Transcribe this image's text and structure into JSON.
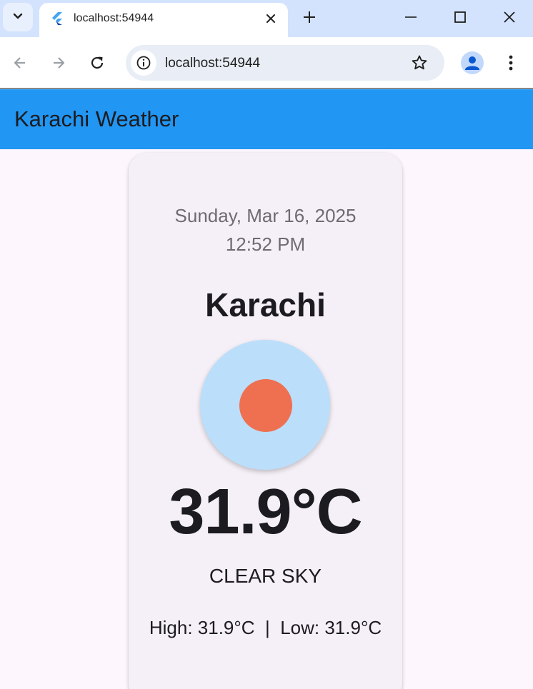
{
  "browser": {
    "tab_title": "localhost:54944",
    "url": "localhost:54944",
    "icons": {
      "tab_search": "chevron-down-icon",
      "favicon": "flutter-icon",
      "tab_close": "close-icon",
      "new_tab": "plus-icon",
      "minimize": "minimize-icon",
      "maximize": "maximize-icon",
      "close_window": "close-icon",
      "back": "arrow-left-icon",
      "forward": "arrow-right-icon",
      "reload": "reload-icon",
      "site_info": "info-icon",
      "bookmark": "star-icon",
      "profile": "person-icon",
      "menu": "kebab-icon"
    }
  },
  "app": {
    "title": "Karachi Weather",
    "colors": {
      "app_bar": "#2196f3",
      "page_bg": "#fdf7fd",
      "card_bg": "#f5f0f7",
      "icon_circle": "#bbdefb",
      "sun": "#ee7050"
    }
  },
  "weather": {
    "date": "Sunday, Mar 16, 2025",
    "time": "12:52 PM",
    "city": "Karachi",
    "temperature": "31.9°C",
    "description": "CLEAR SKY",
    "high_low": "High: 31.9°C  |  Low: 31.9°C",
    "icon": "clear-sky-sun-icon"
  }
}
